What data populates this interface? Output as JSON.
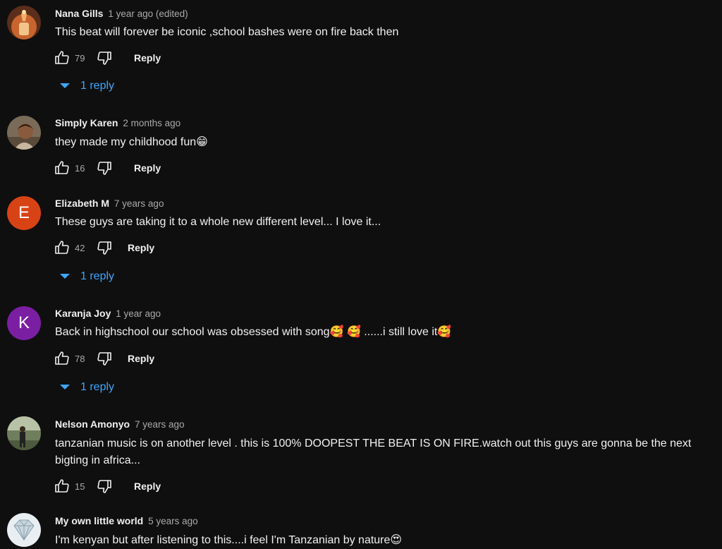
{
  "colors": {
    "background": "#0f0f0f",
    "link": "#3ea6ff",
    "muted": "#aaaaaa",
    "text": "#f1f1f1"
  },
  "icons": {
    "like": "thumbs-up-icon",
    "dislike": "thumbs-down-icon",
    "expand": "caret-down-icon"
  },
  "comments": [
    {
      "author": "Nana Gills",
      "time": "1 year ago (edited)",
      "text": "This beat will forever be iconic ,school bashes were on fire back then",
      "likes": "79",
      "reply_label": "Reply",
      "replies_label": "1 reply",
      "avatar_type": "image",
      "avatar_icon": "candle-photo-avatar"
    },
    {
      "author": "Simply Karen",
      "time": "2 months ago",
      "text": "they made my childhood fun",
      "text_emoji": "😁",
      "likes": "16",
      "reply_label": "Reply",
      "avatar_type": "image",
      "avatar_icon": "portrait-photo-avatar"
    },
    {
      "author": "Elizabeth M",
      "time": "7 years ago",
      "text": "These guys are taking it to a whole new different level... I love it...",
      "likes": "42",
      "reply_label": "Reply",
      "replies_label": "1 reply",
      "avatar_type": "letter",
      "avatar_letter": "E",
      "avatar_color": "#d84315"
    },
    {
      "author": "Karanja Joy",
      "time": "1 year ago",
      "text_parts": [
        "Back in highschool our school was obsessed with song",
        " ......i still love it"
      ],
      "emojis": [
        "🥰",
        "🥰",
        "🥰"
      ],
      "likes": "78",
      "reply_label": "Reply",
      "replies_label": "1 reply",
      "avatar_type": "letter",
      "avatar_letter": "K",
      "avatar_color": "#7b1fa2"
    },
    {
      "author": "Nelson Amonyo",
      "time": "7 years ago",
      "text": "tanzanian  music is on another level . this is 100% DOOPEST  THE BEAT IS ON FIRE.watch out this guys are gonna be the next bigting in africa...",
      "likes": "15",
      "reply_label": "Reply",
      "avatar_type": "image",
      "avatar_icon": "outdoor-photo-avatar"
    },
    {
      "author": "My own little world",
      "time": "5 years ago",
      "text": "I'm kenyan but after listening to this....i feel I'm Tanzanian by nature",
      "text_emoji": "😍",
      "avatar_type": "image",
      "avatar_icon": "diamond-avatar"
    }
  ]
}
